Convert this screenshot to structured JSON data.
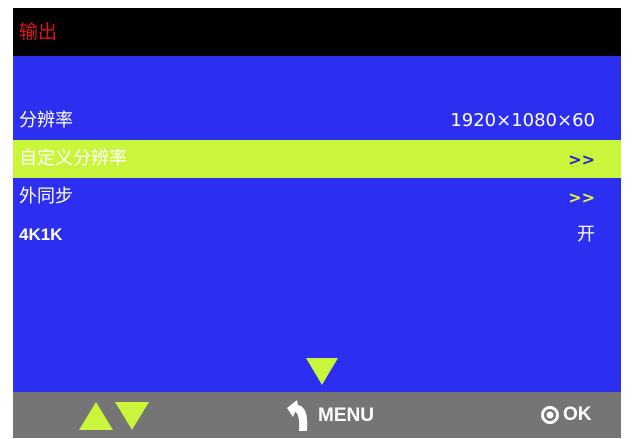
{
  "colors": {
    "background": "#2c2ef0",
    "title_bar": "#000000",
    "title_text": "#e0121e",
    "highlight": "#c9f63a",
    "footer": "#757575"
  },
  "header": {
    "title": "输出"
  },
  "menu": {
    "items": [
      {
        "label": "分辨率",
        "value": "1920×1080×60"
      },
      {
        "label": "自定义分辨率",
        "value": ">>"
      },
      {
        "label": "外同步",
        "value": ">>"
      },
      {
        "label": "4K1K",
        "value": "开"
      }
    ],
    "selected_index": 1
  },
  "footer": {
    "menu_label": "MENU",
    "ok_label": "OK"
  },
  "icons": [
    "scroll-down-icon",
    "arrow-up-icon",
    "arrow-down-icon",
    "back-icon",
    "ok-circle-icon"
  ]
}
